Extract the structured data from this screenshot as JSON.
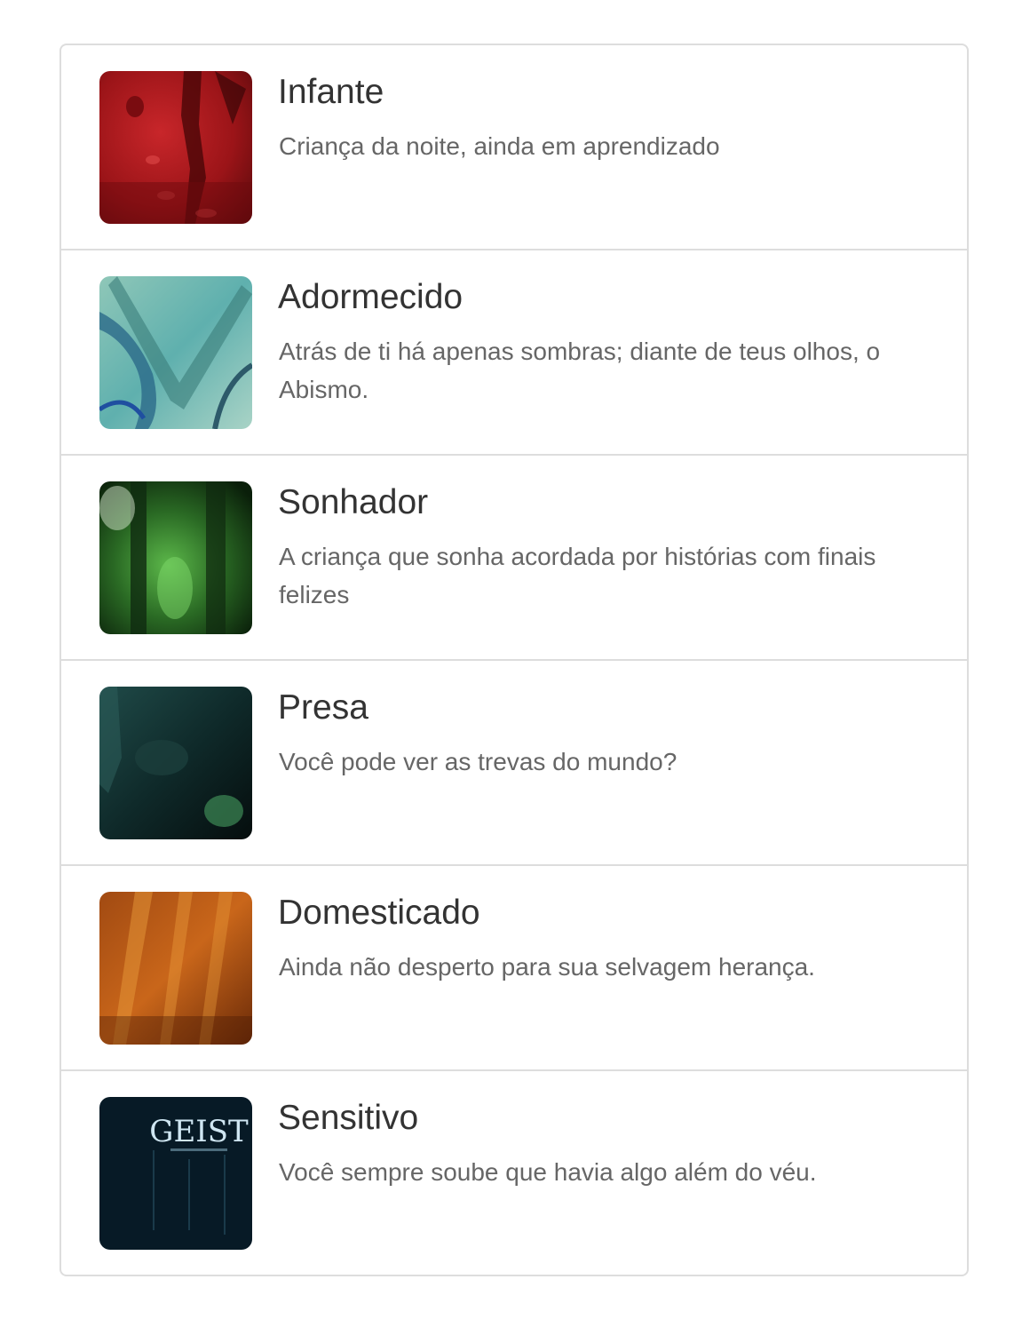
{
  "items": [
    {
      "title": "Infante",
      "description": "Criança da noite, ainda em aprendizado",
      "icon": "blood-art-icon"
    },
    {
      "title": "Adormecido",
      "description": "Atrás de ti há apenas sombras; diante de teus olhos, o Abismo.",
      "icon": "teal-abstract-art-icon"
    },
    {
      "title": "Sonhador",
      "description": "A criança que sonha acordada por histórias com finais felizes",
      "icon": "green-forest-art-icon"
    },
    {
      "title": "Presa",
      "description": "Você pode ver as trevas do mundo?",
      "icon": "dark-teal-art-icon"
    },
    {
      "title": "Domesticado",
      "description": "Ainda não desperto para sua selvagem herança.",
      "icon": "orange-claw-art-icon"
    },
    {
      "title": "Sensitivo",
      "description": "Você sempre soube que havia algo além do véu.",
      "icon": "geist-logo-art-icon",
      "logo_text": "GEIST"
    }
  ],
  "colors": {
    "border": "#dddddd",
    "title": "#333333",
    "description": "#666666"
  }
}
